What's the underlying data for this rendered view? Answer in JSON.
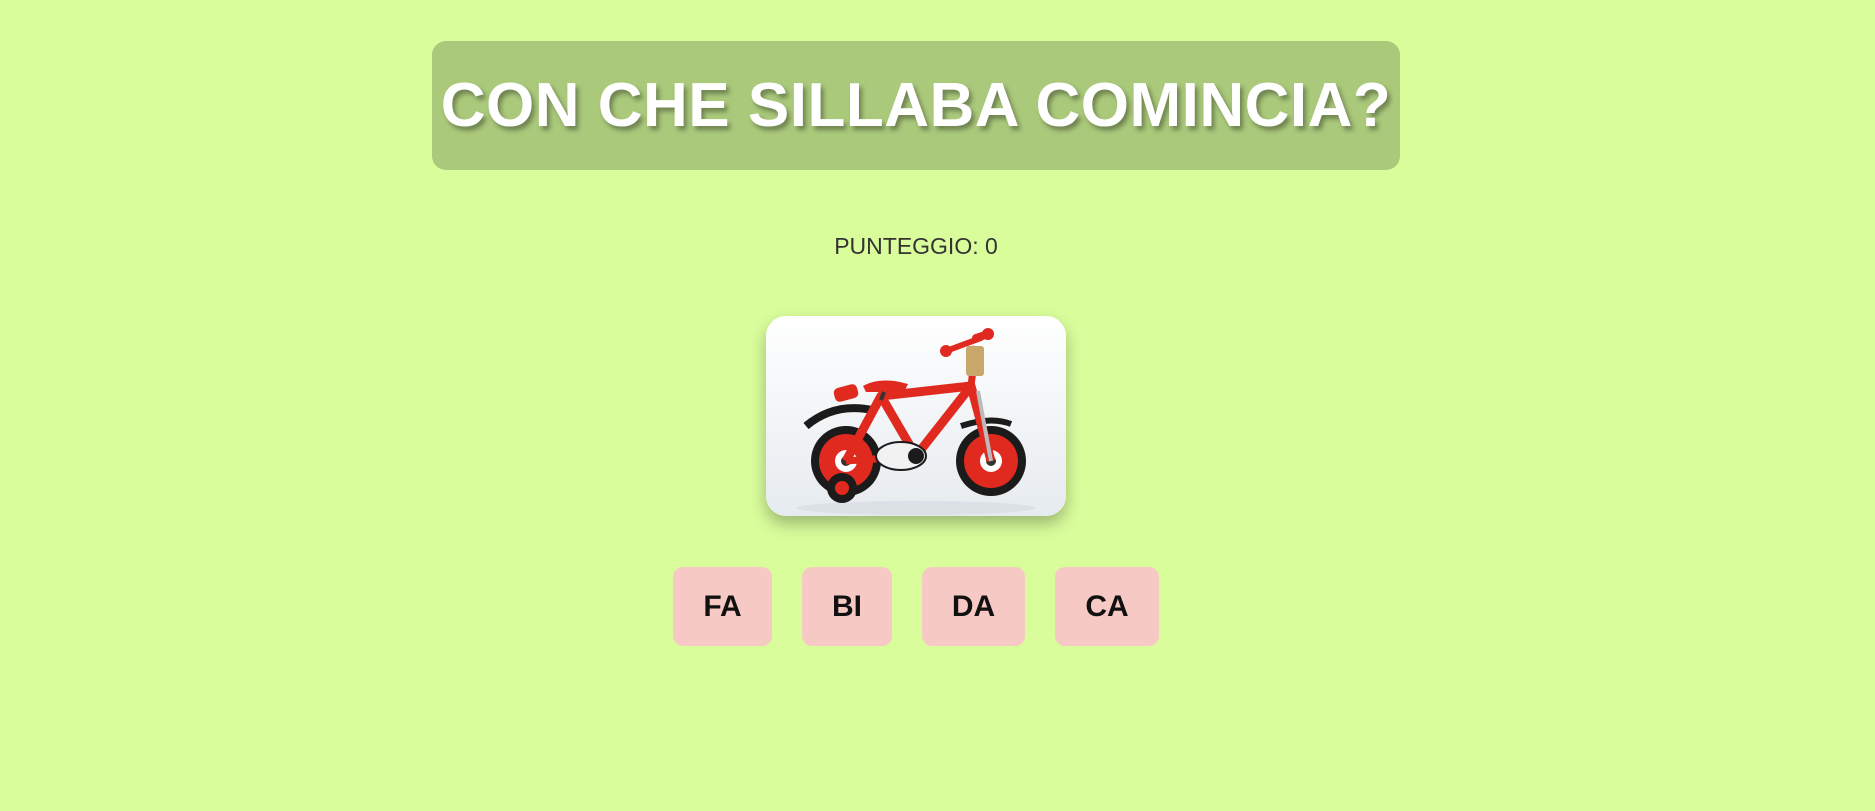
{
  "header": {
    "title": "CON CHE SILLABA COMINCIA?"
  },
  "score": {
    "label": "PUNTEGGIO: 0",
    "value": 0
  },
  "picture": {
    "subject": "bicycle",
    "icon": "bicycle-image"
  },
  "choices": [
    {
      "label": "FA"
    },
    {
      "label": "BI"
    },
    {
      "label": "DA"
    },
    {
      "label": "CA"
    }
  ],
  "colors": {
    "background": "#d9fd9b",
    "title_box": "#aac97b",
    "title_text": "#ffffff",
    "choice_button": "#f7c9c4",
    "bike_red": "#e02a1f"
  }
}
